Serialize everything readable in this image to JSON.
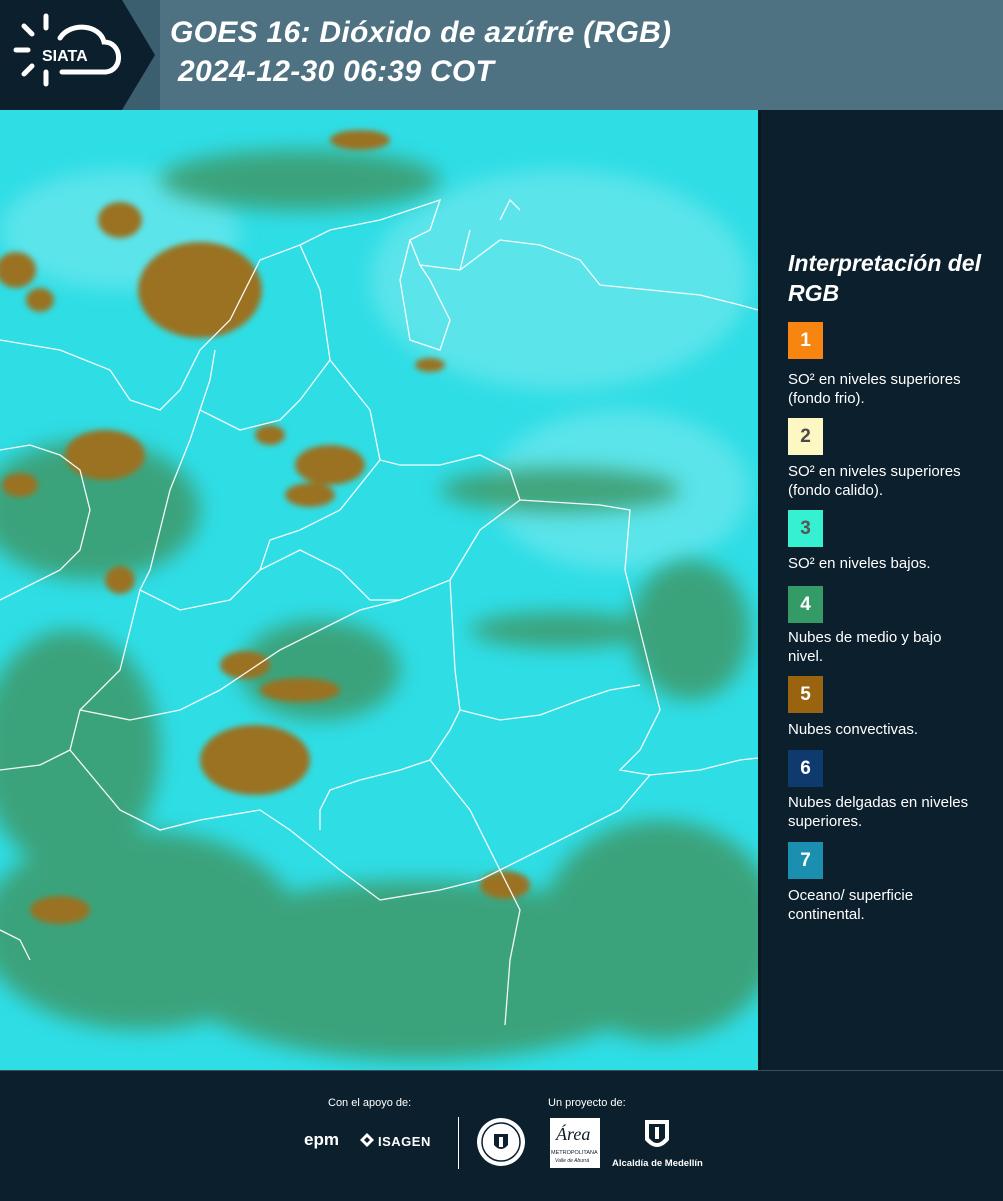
{
  "header": {
    "logo_text": "SIATA",
    "title_line1": "GOES 16: Dióxido de azúfre (RGB)",
    "title_line2": "2024-12-30 06:39 COT"
  },
  "legend": {
    "title": "Interpretación del RGB",
    "items": [
      {
        "number": "1",
        "color": "#f7850f",
        "number_color": "#ffffff",
        "label": "SO² en niveles superiores (fondo frio)."
      },
      {
        "number": "2",
        "color": "#fdf7c3",
        "number_color": "#4a4a4a",
        "label": "SO² en niveles superiores (fondo calido)."
      },
      {
        "number": "3",
        "color": "#35f1d2",
        "number_color": "#555555",
        "label": "SO² en niveles bajos."
      },
      {
        "number": "4",
        "color": "#349a66",
        "number_color": "#ffffff",
        "label": "Nubes de medio y bajo nivel."
      },
      {
        "number": "5",
        "color": "#9a6310",
        "number_color": "#ffffff",
        "label": "Nubes convectivas."
      },
      {
        "number": "6",
        "color": "#0e3a6d",
        "number_color": "#ffffff",
        "label": "Nubes delgadas en niveles superiores."
      },
      {
        "number": "7",
        "color": "#1b8fb0",
        "number_color": "#ffffff",
        "label": "Oceano/ superficie continental."
      }
    ]
  },
  "footer": {
    "support_text": "Con el apoyo de:",
    "project_text": "Un proyecto de:",
    "sponsor1": "epm",
    "sponsor2": "ISAGEN",
    "partner1": "Área",
    "partner1_sub": "METROPOLITANA",
    "partner1_sub2": "Valle de Aburrá",
    "partner2": "Alcaldía de Medellín"
  },
  "colors": {
    "header_bg": "#4f7282",
    "page_bg": "#0c1f2c",
    "map_cyan": "#2fdde5",
    "map_green": "#3e9a6a",
    "map_brown": "#9a7224"
  }
}
